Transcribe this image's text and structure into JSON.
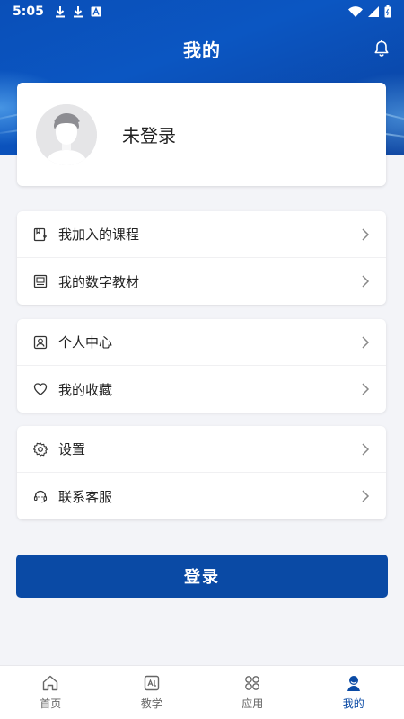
{
  "status_bar": {
    "time": "5:05"
  },
  "header": {
    "title": "我的"
  },
  "profile": {
    "name": "未登录"
  },
  "menu_groups": [
    [
      {
        "label": "我加入的课程",
        "icon": "course-icon"
      },
      {
        "label": "我的数字教材",
        "icon": "book-icon"
      }
    ],
    [
      {
        "label": "个人中心",
        "icon": "person-card-icon"
      },
      {
        "label": "我的收藏",
        "icon": "heart-icon"
      }
    ],
    [
      {
        "label": "设置",
        "icon": "gear-icon"
      },
      {
        "label": "联系客服",
        "icon": "headset-icon"
      }
    ]
  ],
  "login_button": {
    "label": "登录"
  },
  "tabs": [
    {
      "label": "首页",
      "icon": "home-icon"
    },
    {
      "label": "教学",
      "icon": "teaching-icon"
    },
    {
      "label": "应用",
      "icon": "apps-icon"
    },
    {
      "label": "我的",
      "icon": "me-icon",
      "active": true
    }
  ],
  "colors": {
    "primary": "#0a4aa5",
    "hero": "#0b56c2",
    "background": "#f3f4f8"
  }
}
